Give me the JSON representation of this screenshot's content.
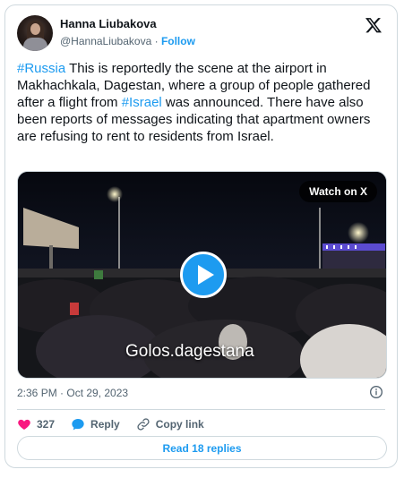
{
  "author": {
    "name": "Hanna Liubakova",
    "handle": "@HannaLiubakova",
    "separator": " · ",
    "follow_label": "Follow"
  },
  "tweet": {
    "hashtag_russia": "#Russia",
    "text_part1": " This is reportedly the scene at the airport in Makhachkala, Dagestan, where a group of people gathered after a flight from ",
    "hashtag_israel": "#Israel",
    "text_part2": " was announced. There have also been reports of messages indicating that apartment owners are refusing to rent to residents from Israel."
  },
  "media": {
    "watch_label": "Watch on X",
    "caption": "Golos.dagestana"
  },
  "meta": {
    "timestamp": "2:36 PM · Oct 29, 2023"
  },
  "actions": {
    "like_count": "327",
    "reply_label": "Reply",
    "copy_label": "Copy link"
  },
  "footer": {
    "read_replies_label": "Read 18 replies"
  },
  "colors": {
    "accent": "#1d9bf0",
    "like": "#f91880",
    "muted": "#536471",
    "border": "#cfd9de"
  },
  "icons": {
    "platform": "x-logo-icon",
    "play": "play-icon",
    "info": "info-icon",
    "like": "heart-icon",
    "reply": "speech-bubble-icon",
    "copy": "link-icon"
  }
}
